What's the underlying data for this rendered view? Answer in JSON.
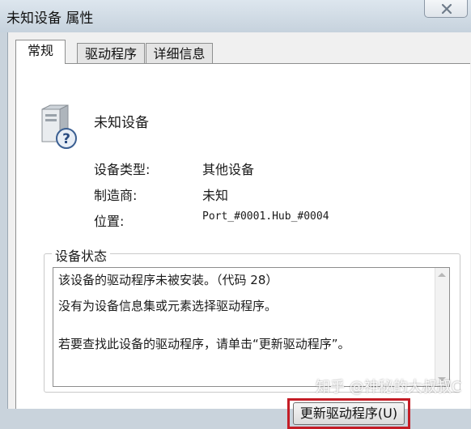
{
  "window": {
    "title": "未知设备 属性"
  },
  "tabs": [
    {
      "label": "常规",
      "active": true
    },
    {
      "label": "驱动程序",
      "active": false
    },
    {
      "label": "详细信息",
      "active": false
    }
  ],
  "device": {
    "icon": "unknown-device-icon",
    "name": "未知设备",
    "properties": [
      {
        "label": "设备类型:",
        "value": "其他设备"
      },
      {
        "label": "制造商:",
        "value": "未知"
      },
      {
        "label": "位置:",
        "value": "Port_#0001.Hub_#0004"
      }
    ]
  },
  "status": {
    "group_label": "设备状态",
    "lines": [
      "该设备的驱动程序未被安装。（代码 28）",
      "没有为设备信息集或元素选择驱动程序。",
      "若要查找此设备的驱动程序，请单击“更新驱动程序”。"
    ]
  },
  "buttons": {
    "update_driver": "更新驱动程序(U)"
  },
  "watermark": "知乎 @神秘的大叔叔C",
  "colors": {
    "highlight": "#c41d26"
  }
}
